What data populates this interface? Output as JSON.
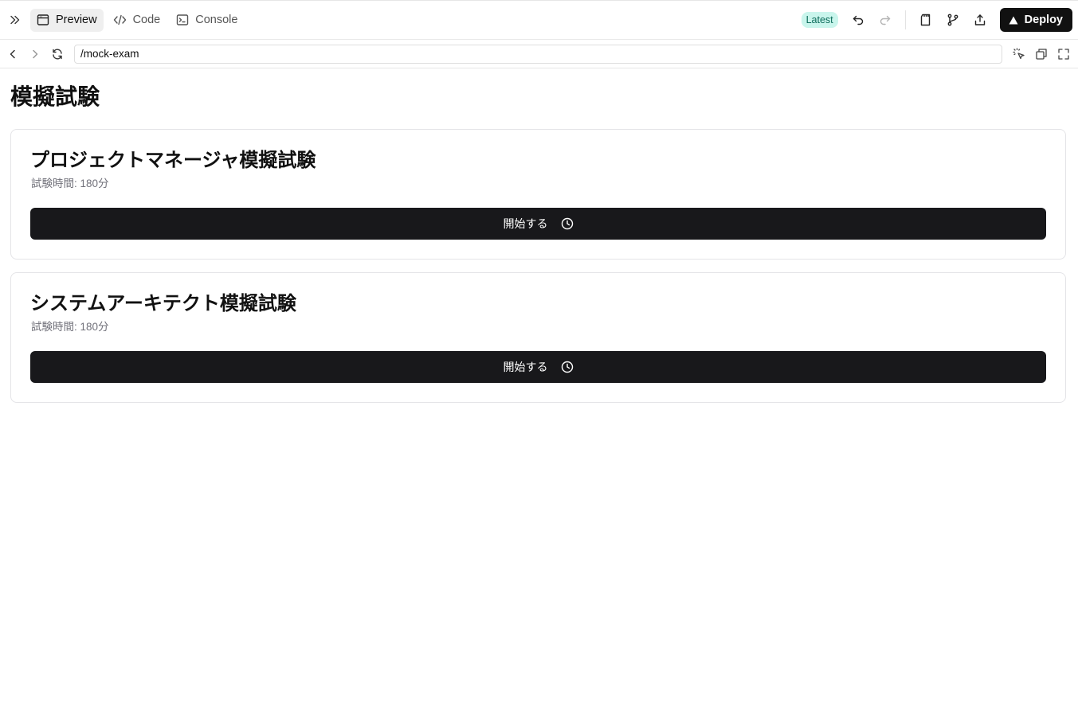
{
  "toolbar": {
    "tabs": [
      {
        "label": "Preview",
        "icon": "browser-window-icon",
        "active": true
      },
      {
        "label": "Code",
        "icon": "code-icon",
        "active": false
      },
      {
        "label": "Console",
        "icon": "terminal-icon",
        "active": false
      }
    ],
    "version_badge": "Latest",
    "deploy_label": "Deploy"
  },
  "address": {
    "url": "/mock-exam"
  },
  "page": {
    "title": "模擬試験",
    "exams": [
      {
        "title": "プロジェクトマネージャ模擬試験",
        "duration": "試験時間: 180分",
        "start_label": "開始する"
      },
      {
        "title": "システムアーキテクト模擬試験",
        "duration": "試験時間: 180分",
        "start_label": "開始する"
      }
    ]
  },
  "colors": {
    "accent_dark": "#18181b",
    "badge_bg": "#c9f5ec",
    "badge_text": "#0b6b5a"
  }
}
